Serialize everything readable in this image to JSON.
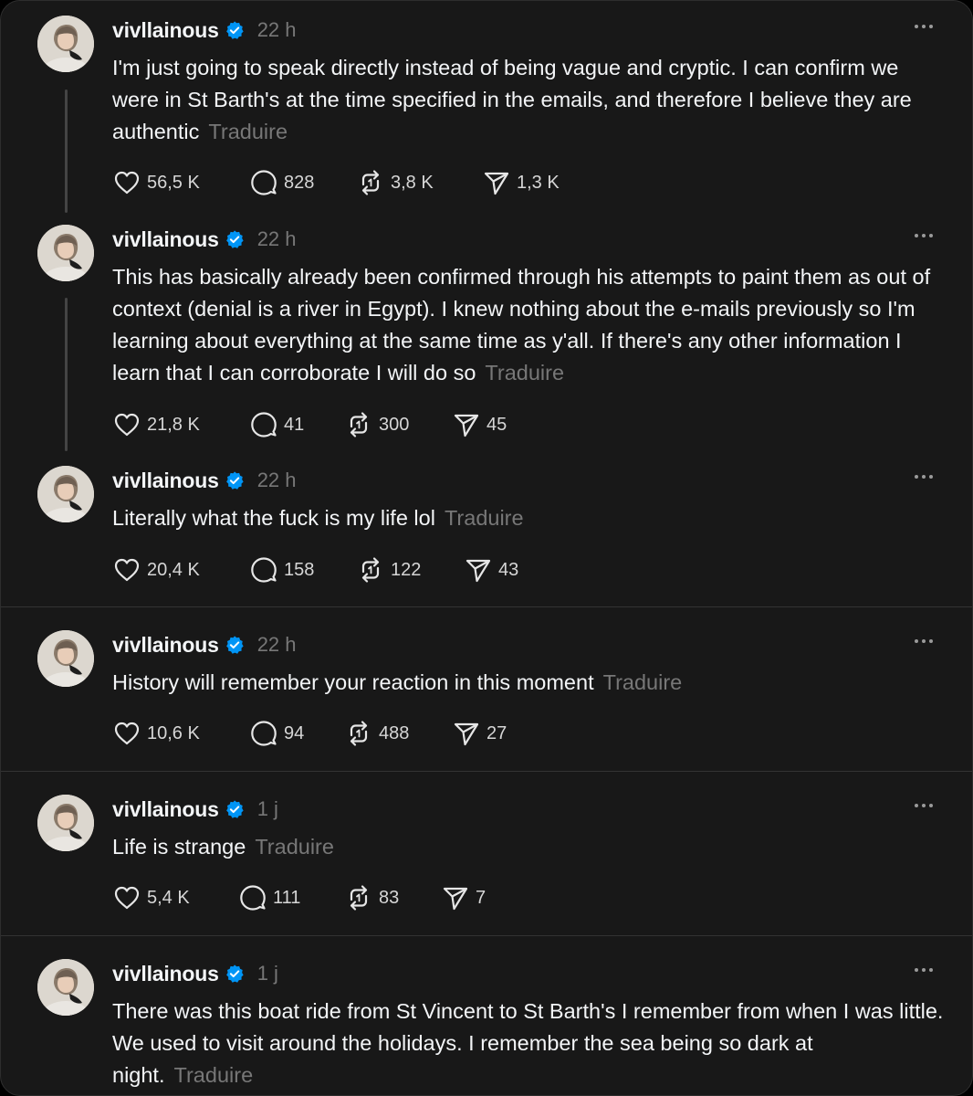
{
  "posts": [
    {
      "username": "vivllainous",
      "time": "22 h",
      "text": "I'm just going to speak directly instead of being vague and cryptic. I can confirm we were in St Barth's at the time specified in the emails, and therefore I believe they are authentic",
      "translate": "Traduire",
      "likes": "56,5 K",
      "replies": "828",
      "reposts": "3,8 K",
      "shares": "1,3 K"
    },
    {
      "username": "vivllainous",
      "time": "22 h",
      "text": "This has basically already been confirmed through his attempts to paint them as out of context (denial is a river in Egypt). I knew nothing about the e-mails previously so I'm learning about everything at the same time as y'all. If there's any other information I learn that I can corroborate I will do so",
      "translate": "Traduire",
      "likes": "21,8 K",
      "replies": "41",
      "reposts": "300",
      "shares": "45"
    },
    {
      "username": "vivllainous",
      "time": "22 h",
      "text": "Literally what the fuck is my life lol",
      "translate": "Traduire",
      "likes": "20,4 K",
      "replies": "158",
      "reposts": "122",
      "shares": "43"
    },
    {
      "username": "vivllainous",
      "time": "22 h",
      "text": "History will remember your reaction in this moment",
      "translate": "Traduire",
      "likes": "10,6 K",
      "replies": "94",
      "reposts": "488",
      "shares": "27"
    },
    {
      "username": "vivllainous",
      "time": "1 j",
      "text": "Life is strange",
      "translate": "Traduire",
      "likes": "5,4 K",
      "replies": "111",
      "reposts": "83",
      "shares": "7"
    },
    {
      "username": "vivllainous",
      "time": "1 j",
      "text": "There was this boat ride from St Vincent to St Barth's I remember from when I was little. We used to visit around the holidays. I remember the sea being so dark at night.",
      "translate": "Traduire",
      "likes": "",
      "replies": "",
      "reposts": "",
      "shares": ""
    }
  ],
  "icons": {
    "like": "heart-icon",
    "reply": "comment-bubble-icon",
    "repost": "repost-arrows-icon",
    "share": "paper-plane-icon",
    "verified": "verified-badge-icon",
    "more": "more-dots-icon"
  },
  "colors": {
    "background": "#181818",
    "text": "#f3f5f7",
    "muted": "#777777",
    "verified": "#0095f6",
    "divider": "#333333"
  }
}
